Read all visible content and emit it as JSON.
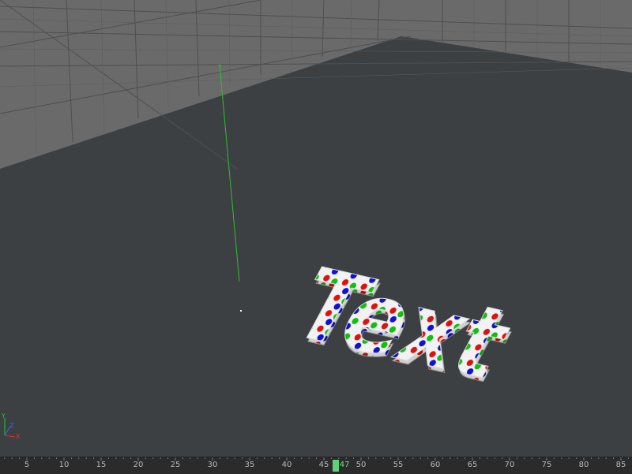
{
  "viewport": {
    "object_text": "Text",
    "colors": {
      "background": "#3c4043",
      "floor": "#6a6a6a",
      "grid_line": "#4a4a4a",
      "axis_y": "#2fbf2f",
      "object_white": "#f2f2f2",
      "dot_red": "#e01010",
      "dot_green": "#10c010",
      "dot_blue": "#1010d8"
    },
    "gizmo": {
      "y_label": "Y",
      "z_label": "Z",
      "x_label": "X"
    }
  },
  "timeline": {
    "tick_labels": [
      "5",
      "10",
      "15",
      "20",
      "25",
      "30",
      "35",
      "40",
      "45",
      "50",
      "55",
      "60",
      "65",
      "70",
      "75",
      "80",
      "85"
    ],
    "current_frame": "47",
    "colors": {
      "playhead": "#5ed17a"
    }
  }
}
